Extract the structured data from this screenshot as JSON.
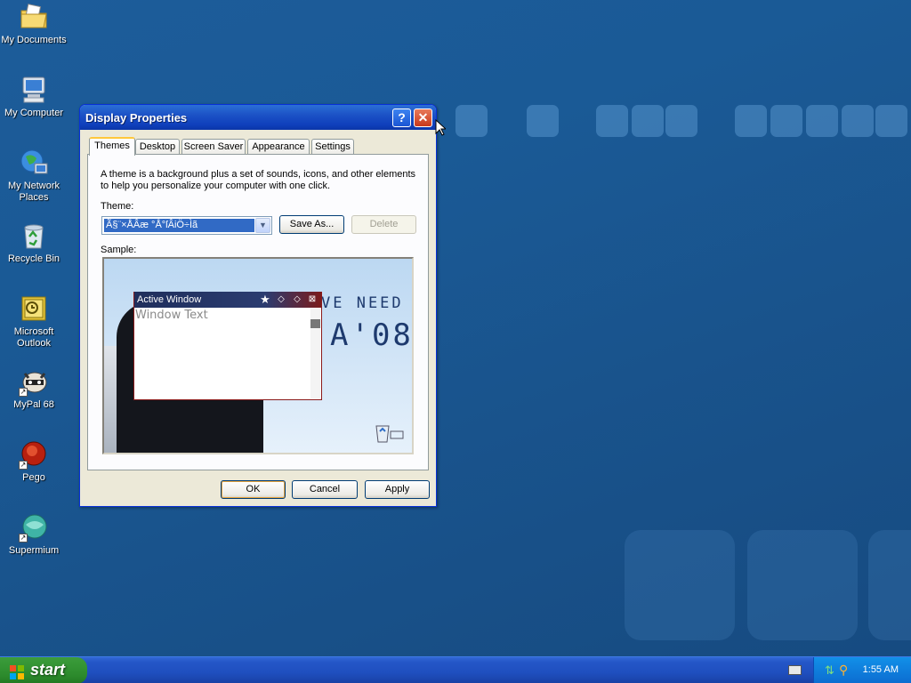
{
  "desktop": {
    "icons": [
      {
        "label": "My Documents",
        "icon": "folder-documents-icon"
      },
      {
        "label": "My Computer",
        "icon": "computer-icon"
      },
      {
        "label": "My Network Places",
        "icon": "network-places-icon"
      },
      {
        "label": "Recycle Bin",
        "icon": "recycle-bin-icon"
      },
      {
        "label": "Microsoft Outlook",
        "icon": "outlook-icon"
      },
      {
        "label": "MyPal 68",
        "icon": "mypal-icon"
      },
      {
        "label": "Pego",
        "icon": "pego-icon"
      },
      {
        "label": "Supermium",
        "icon": "supermium-icon"
      }
    ]
  },
  "dialog": {
    "title": "Display Properties",
    "help_glyph": "?",
    "close_glyph": "✕",
    "tabs": [
      "Themes",
      "Desktop",
      "Screen Saver",
      "Appearance",
      "Settings"
    ],
    "active_tab": "Themes",
    "description": "A theme is a background plus a set of sounds, icons, and other elements to help you personalize your computer with one click.",
    "theme_label": "Theme:",
    "theme_value": "Ã§¨×ÅÂæ °Å°ſÂiÖ÷Ìã",
    "save_as_label": "Save As...",
    "delete_label": "Delete",
    "sample_label": "Sample:",
    "sample": {
      "window_title": "Active Window",
      "window_text": "Window Text",
      "poster_line1": "VE NEED",
      "poster_line2": "A'08"
    },
    "ok_label": "OK",
    "cancel_label": "Cancel",
    "apply_label": "Apply"
  },
  "taskbar": {
    "start_label": "start",
    "clock": "1:55 AM"
  },
  "colors": {
    "desktop": "#1a5a96",
    "titlebar": "#0f3fbb",
    "start": "#2c8a2c",
    "selection": "#316ac5"
  }
}
